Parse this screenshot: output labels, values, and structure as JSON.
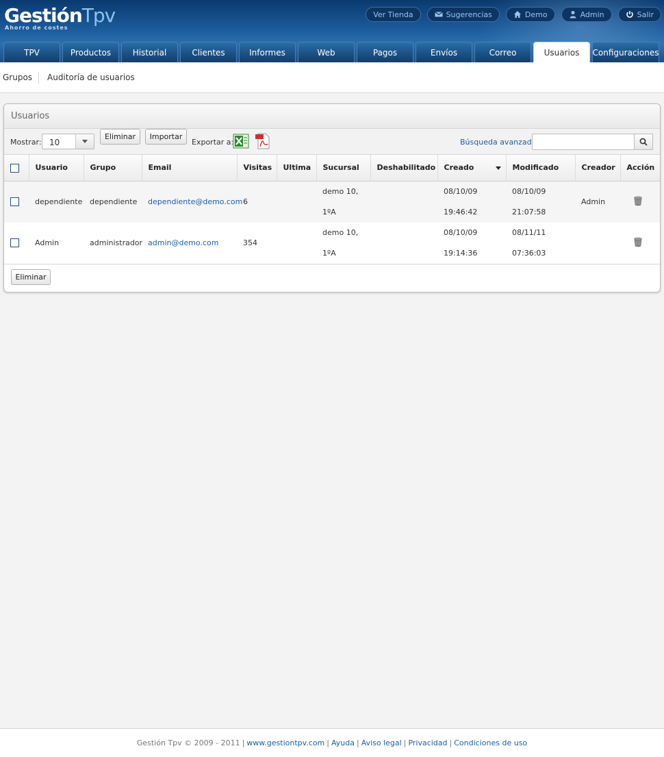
{
  "logo": {
    "part1": "Gestión",
    "part2": "Tpv",
    "tagline": "Ahorro de costes"
  },
  "top_links": [
    {
      "label": "Ver Tienda",
      "icon": "none"
    },
    {
      "label": "Sugerencias",
      "icon": "mail-icon"
    },
    {
      "label": "Demo",
      "icon": "home-icon"
    },
    {
      "label": "Admin",
      "icon": "user-icon"
    },
    {
      "label": "Salir",
      "icon": "power-icon"
    }
  ],
  "tabs": [
    "TPV",
    "Productos",
    "Historial",
    "Clientes",
    "Informes",
    "Web",
    "Pagos",
    "Envíos",
    "Correo",
    "Usuarios",
    "Configuraciones"
  ],
  "active_tab": "Usuarios",
  "subnav": {
    "item1": "Grupos",
    "item2": "Auditoría de usuarios"
  },
  "panel": {
    "title": "Usuarios",
    "toolbar": {
      "show_label": "Mostrar:",
      "show_value": "10",
      "delete_label": "Eliminar",
      "import_label": "Importar",
      "export_label": "Exportar a:",
      "advanced_search": "Búsqueda avanzada",
      "search_value": ""
    },
    "columns": [
      "Usuario",
      "Grupo",
      "Email",
      "Visitas",
      "Ultima",
      "Sucursal",
      "Deshabilitado",
      "Creado",
      "Modificado",
      "Creador",
      "Acción"
    ],
    "rows": [
      {
        "usuario": "dependiente",
        "grupo": "dependiente",
        "email": "dependiente@demo.com",
        "visitas": "6",
        "ultima": "",
        "sucursal_1": "demo 10,",
        "sucursal_2": "1ºA",
        "deshabilitado": "",
        "creado_fecha": "08/10/09",
        "creado_hora": "19:46:42",
        "modificado_fecha": "08/10/09",
        "modificado_hora": "21:07:58",
        "creador": "Admin"
      },
      {
        "usuario": "Admin",
        "grupo": "administrador",
        "email": "admin@demo.com",
        "visitas": "354",
        "ultima": "",
        "sucursal_1": "demo 10,",
        "sucursal_2": "1ºA",
        "deshabilitado": "",
        "creado_fecha": "08/10/09",
        "creado_hora": "19:14:36",
        "modificado_fecha": "08/11/11",
        "modificado_hora": "07:36:03",
        "creador": ""
      }
    ],
    "bottom_delete_label": "Eliminar"
  },
  "footer": {
    "copyright": "Gestión Tpv © 2009 - 2011",
    "site": "www.gestiontpv.com",
    "help": "Ayuda",
    "legal": "Aviso legal",
    "privacy": "Privacidad",
    "terms": "Condiciones de uso"
  },
  "colors": {
    "header_dark": "#0a3a6e",
    "header_light": "#2c6fae",
    "link": "#1d5fa6",
    "tab_active": "#ffffff"
  }
}
